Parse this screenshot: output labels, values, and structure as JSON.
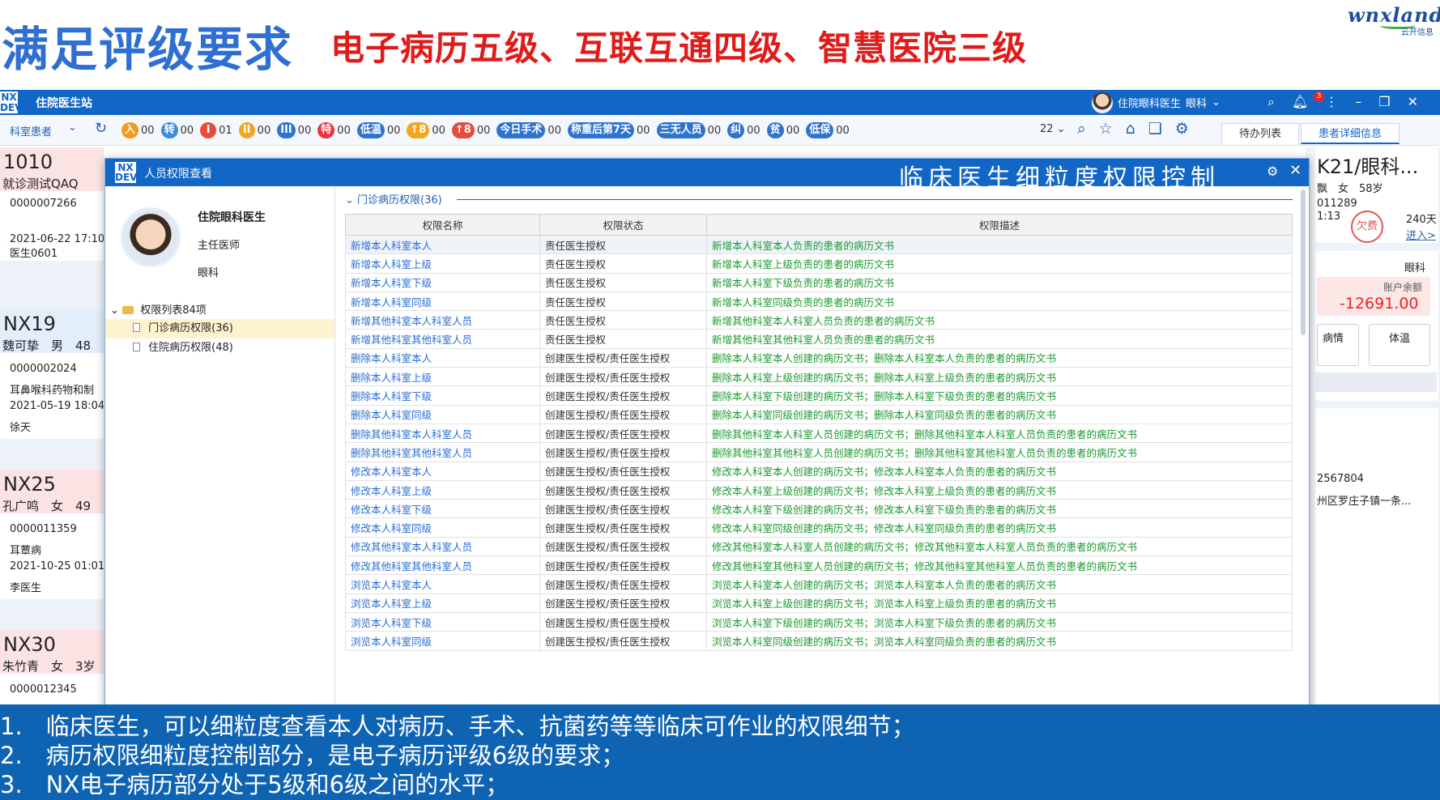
{
  "slide": {
    "title": "满足评级要求",
    "subtitle": "电子病历五级、互联互通四级、智慧医院三级",
    "logo": {
      "brand": "wnxland",
      "cn": "云开信息"
    }
  },
  "appbar": {
    "logo": "NX DEV",
    "app_name": "住院医生站",
    "user": "住院眼科医生",
    "dept": "眼科",
    "notification_count": "3"
  },
  "toolbar": {
    "dept_label": "科室患者",
    "chips": [
      {
        "icon": "入",
        "count": "00",
        "color": "#f29b1d"
      },
      {
        "icon": "转",
        "count": "00",
        "color": "#3c8edb"
      },
      {
        "icon": "I",
        "count": "01",
        "color": "#e84a3c"
      },
      {
        "icon": "II",
        "count": "00",
        "color": "#f2a71b"
      },
      {
        "icon": "III",
        "count": "00",
        "color": "#2e74cf"
      },
      {
        "icon": "特",
        "count": "00",
        "color": "#e8363f"
      },
      {
        "icon": "低温",
        "count": "00",
        "color": "#2e74cf"
      },
      {
        "icon": "↑8",
        "count": "00",
        "color": "#f2a71b"
      },
      {
        "icon": "↑8",
        "count": "00",
        "color": "#e84a3c"
      },
      {
        "icon": "今日手术",
        "count": "00",
        "color": "#2e74cf"
      },
      {
        "icon": "称重后第7天",
        "count": "00",
        "color": "#2e74cf"
      },
      {
        "icon": "三无人员",
        "count": "00",
        "color": "#2e74cf"
      },
      {
        "icon": "纠",
        "count": "00",
        "color": "#2e74cf"
      },
      {
        "icon": "贫",
        "count": "00",
        "color": "#2e74cf"
      },
      {
        "icon": "低保",
        "count": "00",
        "color": "#2e74cf"
      }
    ],
    "page_count": "22",
    "tab_todo": "待办列表",
    "tab_detail": "患者详细信息"
  },
  "patients": [
    {
      "bed": "1010",
      "name": "就诊测试QAQ",
      "id": "0000007266",
      "diag": "",
      "date": "2021-06-22 17:10",
      "doctor": "医生0601"
    },
    {
      "bed": "NX19",
      "name": "魏可挚　男　48",
      "id": "0000002024",
      "diag": "耳鼻喉科药物和制",
      "date": "2021-05-19 18:04",
      "doctor": "徐天"
    },
    {
      "bed": "NX25",
      "name": "孔广鸣　女　49",
      "id": "0000011359",
      "diag": "耳蕈病",
      "date": "2021-10-25 01:01",
      "doctor": "李医生"
    },
    {
      "bed": "NX30",
      "name": "朱竹青　女　3岁",
      "id": "0000012345",
      "diag": "",
      "date": "",
      "doctor": ""
    }
  ],
  "right_panel": {
    "bed": "K21/眼科...",
    "name_sex_age": "飘　女　58岁",
    "id_fragment": "011289",
    "time_fragment": "1:13",
    "owe_stamp": "欠费",
    "days": "240天",
    "enter": "进入>",
    "dept": "眼科",
    "balance_label": "账户余额",
    "balance": "-12691.00",
    "btn_illness": "病情",
    "btn_temp": "体温",
    "phone_fragment": "2567804",
    "address_fragment": "州区罗庄子镇一条..."
  },
  "dialog": {
    "logo": "NX DEV",
    "title": "人员权限查看",
    "headline": "临床医生细粒度权限控制",
    "doctor": {
      "name": "住院眼科医生",
      "title": "主任医师",
      "dept": "眼科"
    },
    "tree": {
      "root": "权限列表84项",
      "items": [
        "门诊病历权限(36)",
        "住院病历权限(48)"
      ]
    },
    "section_header": "门诊病历权限(36)",
    "columns": [
      "权限名称",
      "权限状态",
      "权限描述"
    ],
    "rows": [
      [
        "新增本人科室本人",
        "责任医生授权",
        "新增本人科室本人负责的患者的病历文书"
      ],
      [
        "新增本人科室上级",
        "责任医生授权",
        "新增本人科室上级负责的患者的病历文书"
      ],
      [
        "新增本人科室下级",
        "责任医生授权",
        "新增本人科室下级负责的患者的病历文书"
      ],
      [
        "新增本人科室同级",
        "责任医生授权",
        "新增本人科室同级负责的患者的病历文书"
      ],
      [
        "新增其他科室本人科室人员",
        "责任医生授权",
        "新增其他科室本人科室人员负责的患者的病历文书"
      ],
      [
        "新增其他科室其他科室人员",
        "责任医生授权",
        "新增其他科室其他科室人员负责的患者的病历文书"
      ],
      [
        "删除本人科室本人",
        "创建医生授权/责任医生授权",
        "删除本人科室本人创建的病历文书；删除本人科室本人负责的患者的病历文书"
      ],
      [
        "删除本人科室上级",
        "创建医生授权/责任医生授权",
        "删除本人科室上级创建的病历文书；删除本人科室上级负责的患者的病历文书"
      ],
      [
        "删除本人科室下级",
        "创建医生授权/责任医生授权",
        "删除本人科室下级创建的病历文书；删除本人科室下级负责的患者的病历文书"
      ],
      [
        "删除本人科室同级",
        "创建医生授权/责任医生授权",
        "删除本人科室同级创建的病历文书；删除本人科室同级负责的患者的病历文书"
      ],
      [
        "删除其他科室本人科室人员",
        "创建医生授权/责任医生授权",
        "删除其他科室本人科室人员创建的病历文书；删除其他科室本人科室人员负责的患者的病历文书"
      ],
      [
        "删除其他科室其他科室人员",
        "创建医生授权/责任医生授权",
        "删除其他科室其他科室人员创建的病历文书；删除其他科室其他科室人员负责的患者的病历文书"
      ],
      [
        "修改本人科室本人",
        "创建医生授权/责任医生授权",
        "修改本人科室本人创建的病历文书；修改本人科室本人负责的患者的病历文书"
      ],
      [
        "修改本人科室上级",
        "创建医生授权/责任医生授权",
        "修改本人科室上级创建的病历文书；修改本人科室上级负责的患者的病历文书"
      ],
      [
        "修改本人科室下级",
        "创建医生授权/责任医生授权",
        "修改本人科室下级创建的病历文书；修改本人科室下级负责的患者的病历文书"
      ],
      [
        "修改本人科室同级",
        "创建医生授权/责任医生授权",
        "修改本人科室同级创建的病历文书；修改本人科室同级负责的患者的病历文书"
      ],
      [
        "修改其他科室本人科室人员",
        "创建医生授权/责任医生授权",
        "修改其他科室本人科室人员创建的病历文书；修改其他科室本人科室人员负责的患者的病历文书"
      ],
      [
        "修改其他科室其他科室人员",
        "创建医生授权/责任医生授权",
        "修改其他科室其他科室人员创建的病历文书；修改其他科室其他科室人员负责的患者的病历文书"
      ],
      [
        "浏览本人科室本人",
        "创建医生授权/责任医生授权",
        "浏览本人科室本人创建的病历文书；浏览本人科室本人负责的患者的病历文书"
      ],
      [
        "浏览本人科室上级",
        "创建医生授权/责任医生授权",
        "浏览本人科室上级创建的病历文书；浏览本人科室上级负责的患者的病历文书"
      ],
      [
        "浏览本人科室下级",
        "创建医生授权/责任医生授权",
        "浏览本人科室下级创建的病历文书；浏览本人科室下级负责的患者的病历文书"
      ],
      [
        "浏览本人科室同级",
        "创建医生授权/责任医生授权",
        "浏览本人科室同级创建的病历文书；浏览本人科室同级负责的患者的病历文书"
      ]
    ]
  },
  "caption": [
    "1.　临床医生，可以细粒度查看本人对病历、手术、抗菌药等等临床可作业的权限细节；",
    "2.　病历权限细粒度控制部分，是电子病历评级6级的要求；",
    "3.　NX电子病历部分处于5级和6级之间的水平；"
  ]
}
